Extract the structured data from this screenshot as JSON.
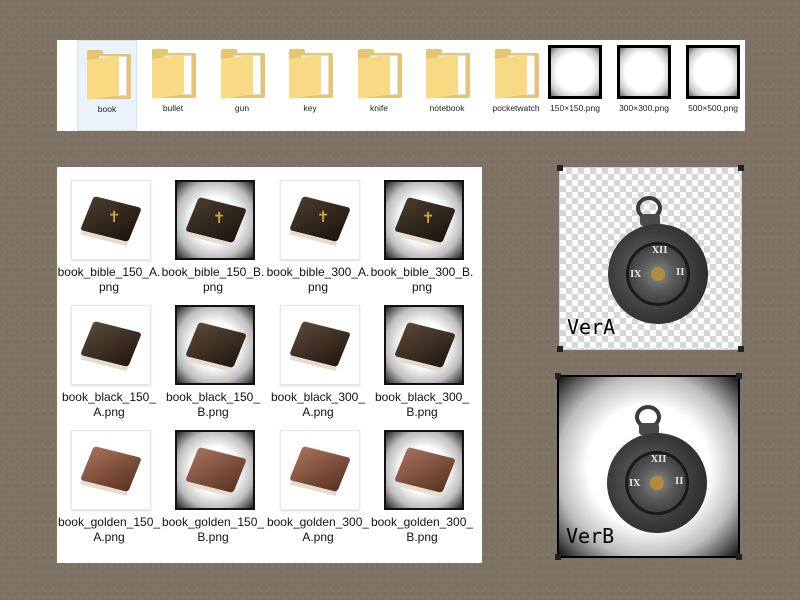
{
  "top_strip": {
    "items": [
      {
        "label": "book",
        "kind": "folder",
        "icon": "book-thumbnail",
        "glyph": "▮",
        "selected": true
      },
      {
        "label": "bullet",
        "kind": "folder",
        "icon": "bullet-thumbnail",
        "glyph": "",
        "selected": false
      },
      {
        "label": "gun",
        "kind": "folder",
        "icon": "gun-thumbnail",
        "glyph": "⌐",
        "selected": false
      },
      {
        "label": "key",
        "kind": "folder",
        "icon": "key-thumbnail",
        "glyph": "⚷",
        "selected": false
      },
      {
        "label": "knife",
        "kind": "folder",
        "icon": "knife-thumbnail",
        "glyph": "⟋",
        "selected": false
      },
      {
        "label": "notebook",
        "kind": "folder",
        "icon": "notebook-thumbnail",
        "glyph": "▮",
        "selected": false
      },
      {
        "label": "pocketwatch",
        "kind": "folder",
        "icon": "pocketwatch-thumbnail",
        "glyph": "◍",
        "selected": false
      },
      {
        "label": "150×150.png",
        "kind": "png",
        "icon": "vignette-frame-thumbnail",
        "glyph": "",
        "selected": false
      },
      {
        "label": "300×300.png",
        "kind": "png",
        "icon": "vignette-frame-thumbnail",
        "glyph": "",
        "selected": false
      },
      {
        "label": "500×500.png",
        "kind": "png",
        "icon": "vignette-frame-thumbnail",
        "glyph": "",
        "selected": false
      }
    ]
  },
  "grid": {
    "items": [
      {
        "label": "book_bible_150_A.png",
        "variant": "A",
        "book": "bible"
      },
      {
        "label": "book_bible_150_B.png",
        "variant": "B",
        "book": "bible"
      },
      {
        "label": "book_bible_300_A.png",
        "variant": "A",
        "book": "bible"
      },
      {
        "label": "book_bible_300_B.png",
        "variant": "B",
        "book": "bible"
      },
      {
        "label": "book_black_150_A.png",
        "variant": "A",
        "book": "black"
      },
      {
        "label": "book_black_150_B.png",
        "variant": "B",
        "book": "black"
      },
      {
        "label": "book_black_300_A.png",
        "variant": "A",
        "book": "black"
      },
      {
        "label": "book_black_300_B.png",
        "variant": "B",
        "book": "black"
      },
      {
        "label": "book_golden_150_A.png",
        "variant": "A",
        "book": "golden"
      },
      {
        "label": "book_golden_150_B.png",
        "variant": "B",
        "book": "golden"
      },
      {
        "label": "book_golden_300_A.png",
        "variant": "A",
        "book": "golden"
      },
      {
        "label": "book_golden_300_B.png",
        "variant": "B",
        "book": "golden"
      }
    ]
  },
  "previews": {
    "ver_a": {
      "label": "VerA",
      "icon": "pocketwatch-image"
    },
    "ver_b": {
      "label": "VerB",
      "icon": "pocketwatch-image"
    }
  },
  "colors": {
    "background": "#7d7264",
    "folder": "#f8d984",
    "selection": "#eaf3fb"
  }
}
